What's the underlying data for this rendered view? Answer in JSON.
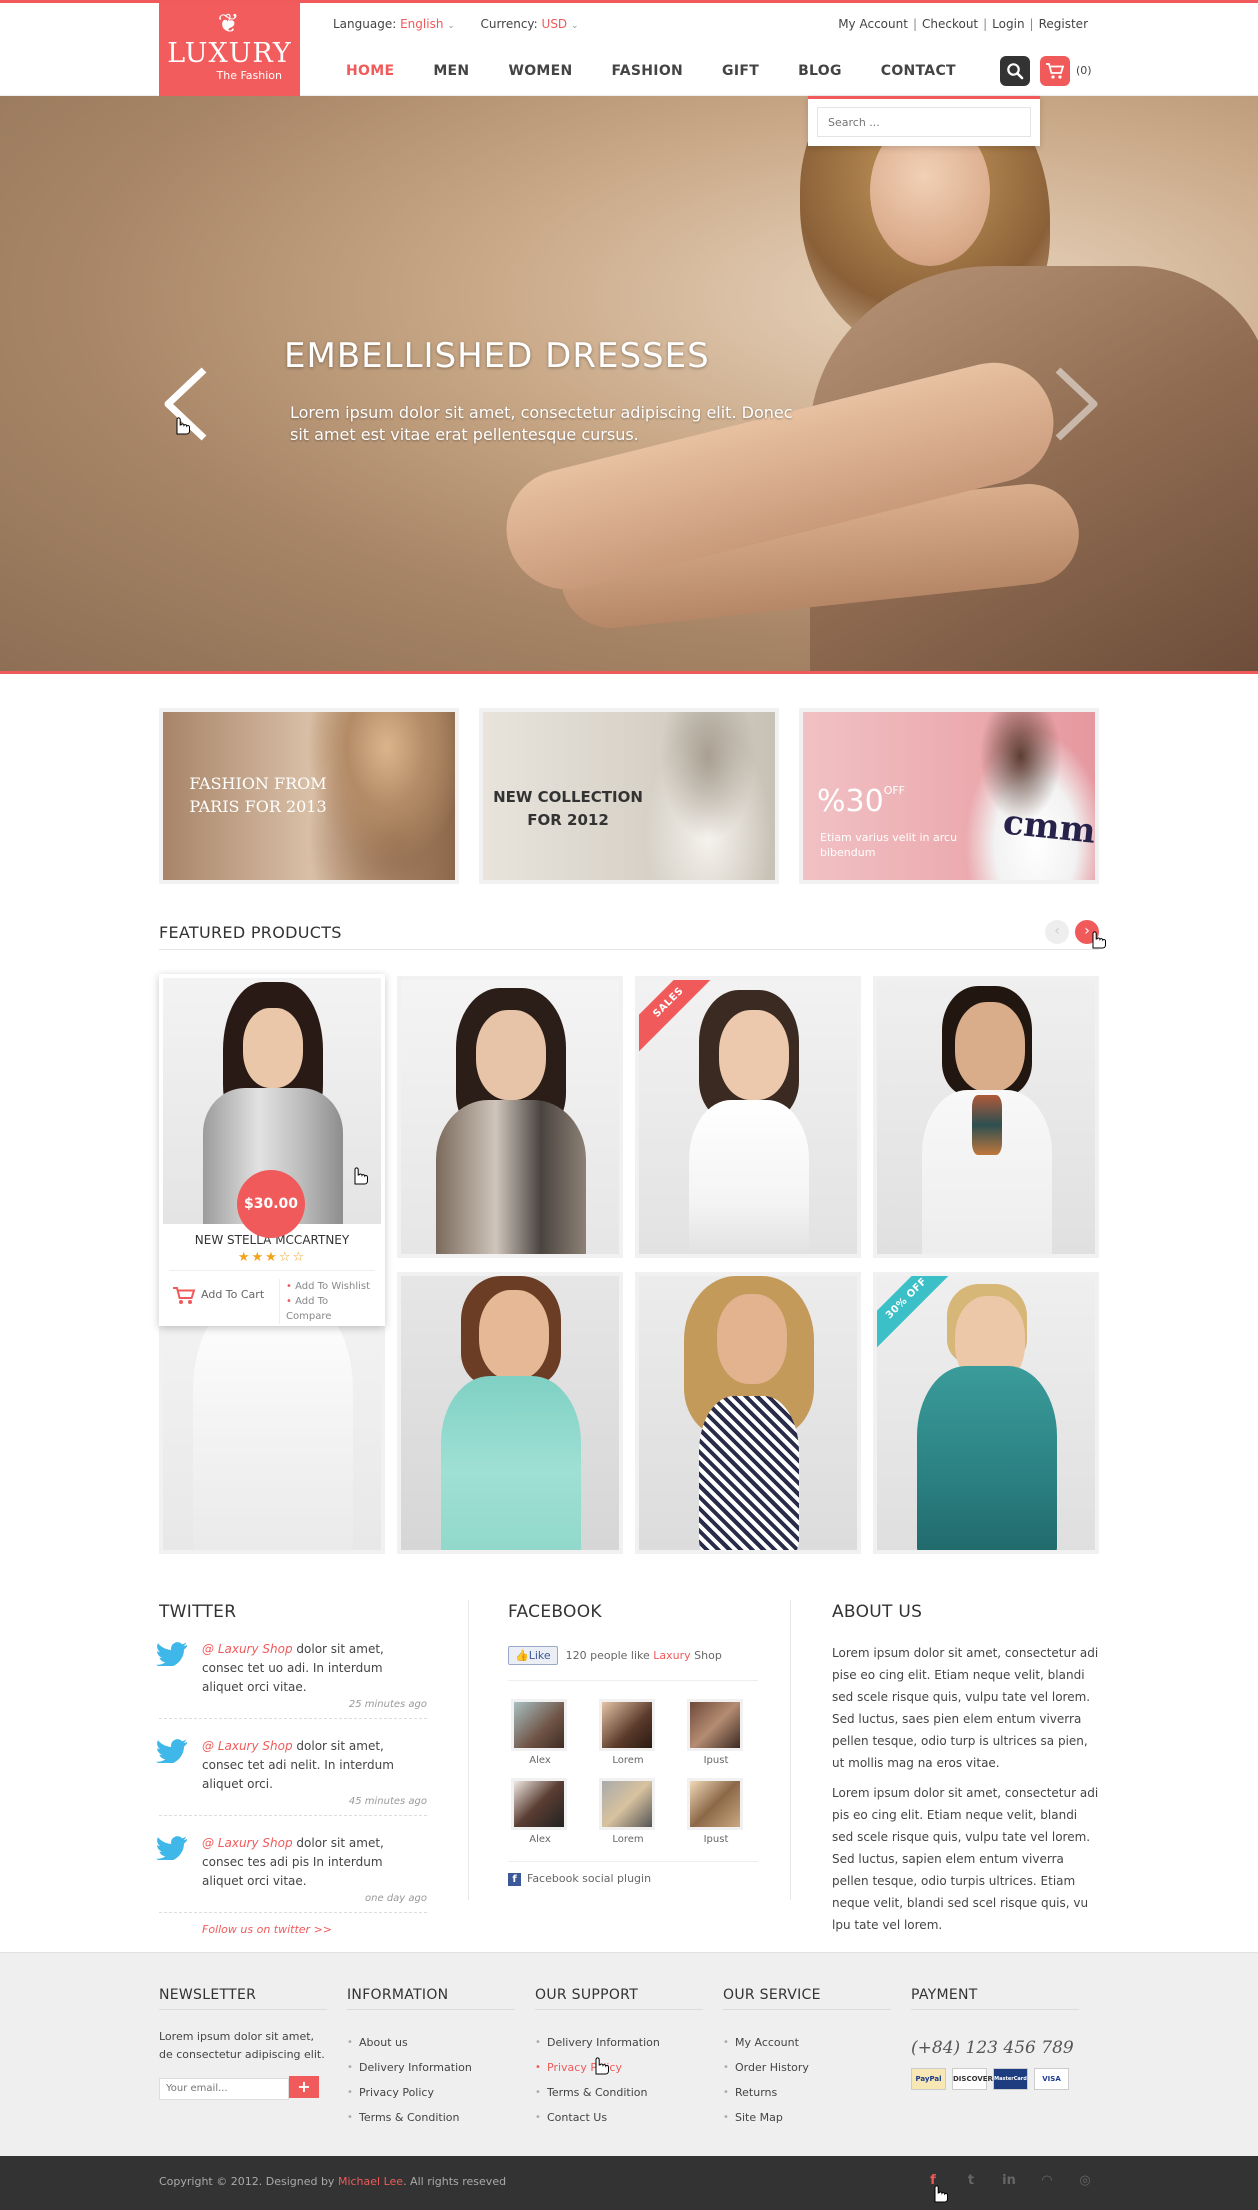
{
  "header": {
    "logo": {
      "brand": "LUXURY",
      "tagline": "The Fashion",
      "ornament": "❦"
    },
    "language_label": "Language:",
    "language_value": "English",
    "currency_label": "Currency:",
    "currency_value": "USD",
    "account_links": [
      "My Account",
      "Checkout",
      "Login",
      "Register"
    ],
    "nav": [
      "HOME",
      "MEN",
      "WOMEN",
      "FASHION",
      "GIFT",
      "BLOG",
      "CONTACT"
    ],
    "cart_count": "(0)",
    "search_placeholder": "Search ..."
  },
  "hero": {
    "title": "EMBELLISHED DRESSES",
    "text": "Lorem ipsum dolor sit amet, consectetur adipiscing elit. Donec sit amet est vitae erat pellentesque cursus."
  },
  "banners": {
    "b1": "FASHION FROM PARIS FOR 2013",
    "b2": "NEW COLLECTION FOR 2012",
    "b3_pct": "%30",
    "b3_off": "OFF",
    "b3_sub": "Etiam varius velit in arcu bibendum"
  },
  "featured": {
    "title": "FEATURED PRODUCTS",
    "prev": "‹",
    "next": "›",
    "hover_product": {
      "price": "$30.00",
      "name": "NEW STELLA MCCARTNEY",
      "rating": 3,
      "stars": "★★★☆☆",
      "add_to_cart": "Add To Cart",
      "add_to_wishlist": "Add To Wishlist",
      "add_to_compare": "Add To Compare"
    },
    "ribbons": {
      "sales": "SALES",
      "off": "30% OFF"
    }
  },
  "twitter": {
    "title": "TWITTER",
    "tweets": [
      {
        "handle": "@ Laxury Shop",
        "text": " dolor sit amet, consec tet uo adi. In interdum aliquet orci vitae.",
        "time": "25 minutes ago"
      },
      {
        "handle": "@ Laxury Shop",
        "text": " dolor sit amet, consec tet adi nelit. In interdum aliquet orci.",
        "time": "45 minutes ago"
      },
      {
        "handle": "@ Laxury Shop",
        "text": " dolor sit amet, consec tes adi pis In interdum aliquet orci vitae.",
        "time": "one day ago"
      }
    ],
    "follow": "Follow us on twitter >>"
  },
  "facebook": {
    "title": "FACEBOOK",
    "like_button": "Like",
    "like_text_1": "120 people like ",
    "like_brand": "Laxury",
    "like_text_2": " Shop",
    "faces": [
      "Alex",
      "Lorem",
      "Ipust",
      "Alex",
      "Lorem",
      "Ipust"
    ],
    "plugin": "Facebook social plugin"
  },
  "about": {
    "title": "ABOUT US",
    "p1": "Lorem ipsum dolor sit amet, consectetur adi pise eo cing elit. Etiam neque velit, blandi  sed scele risque quis, vulpu tate vel lorem. Sed luctus, saes pien elem entum viverra pellen tesque, odio turp is ultrices sa pien, ut mollis mag na eros vitae.",
    "p2": "Lorem ipsum dolor sit amet, consectetur adi pis eo cing elit. Etiam neque velit, blandi  sed scele risque quis, vulpu tate vel lorem. Sed luctus, sapien elem entum viverra pellen tesque, odio turpis ultrices. Etiam neque velit, blandi  sed scel risque quis, vu lpu tate vel lorem."
  },
  "footer": {
    "newsletter": {
      "title": "NEWSLETTER",
      "text": "Lorem ipsum dolor sit amet, de consectetur adipiscing elit.",
      "placeholder": "Your email...",
      "button": "+"
    },
    "information": {
      "title": "INFORMATION",
      "items": [
        "About us",
        "Delivery Information",
        "Privacy Policy",
        "Terms & Condition"
      ]
    },
    "support": {
      "title": "OUR SUPPORT",
      "items": [
        "Delivery Information",
        "Privacy Policy",
        "Terms & Condition",
        "Contact Us"
      ]
    },
    "service": {
      "title": "OUR SERVICE",
      "items": [
        "My Account",
        "Order History",
        "Returns",
        "Site Map"
      ]
    },
    "payment": {
      "title": "PAYMENT",
      "phone": "(+84) 123 456 789",
      "cards": [
        "PayPal",
        "DISCOVER",
        "MasterCard",
        "VISA"
      ]
    }
  },
  "bottom": {
    "copyright_1": "Copyright © 2012. Designed by ",
    "designer": "Michael Lee",
    "copyright_2": ". All rights reseved",
    "social": [
      "f",
      "t",
      "in",
      "rss",
      "dribbble"
    ]
  },
  "colors": {
    "accent": "#f05a5a",
    "dark": "#333333",
    "footer_bg": "#efefef",
    "teal": "#3cc0c7"
  }
}
